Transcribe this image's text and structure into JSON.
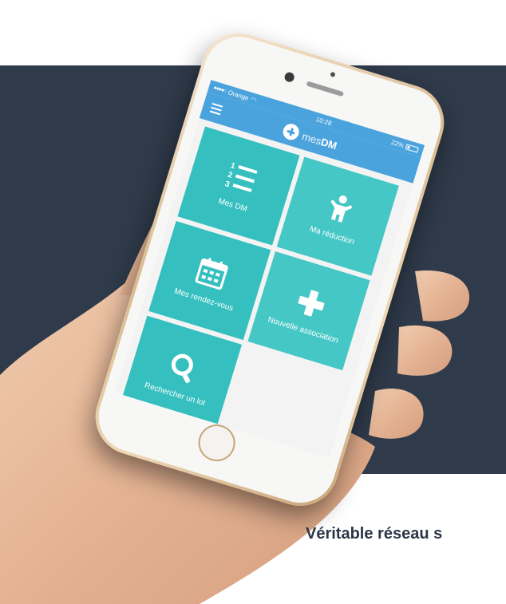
{
  "status_bar": {
    "carrier": "Orange",
    "time": "10:28",
    "battery": "22%",
    "battery_level": 0.22
  },
  "app": {
    "name_light": "mes",
    "name_bold": "DM"
  },
  "tiles": [
    {
      "label": "Mes DM",
      "icon": "numbered-list-icon"
    },
    {
      "label": "Ma réduction",
      "icon": "child-figure-icon"
    },
    {
      "label": "Mes rendez-vous",
      "icon": "calendar-icon"
    },
    {
      "label": "Nouvelle association",
      "icon": "plus-icon"
    },
    {
      "label": "Rechercher un lot",
      "icon": "search-icon"
    }
  ],
  "caption": "Véritable réseau s",
  "colors": {
    "background_band": "#2f3a4a",
    "app_bar": "#4aa3dd",
    "tile": "#36bfbf",
    "caption": "#2c3646"
  }
}
